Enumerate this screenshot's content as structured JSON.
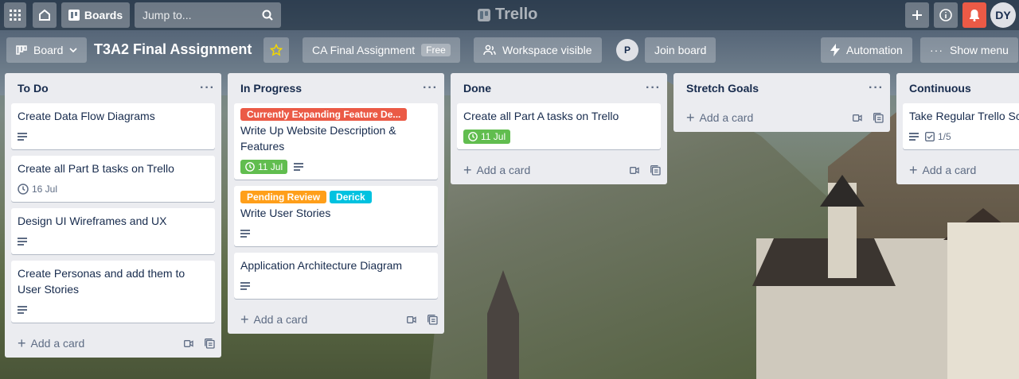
{
  "topbar": {
    "boards_label": "Boards",
    "search_placeholder": "Jump to...",
    "logo_text": "Trello",
    "avatar_initials": "DY"
  },
  "boardbar": {
    "view_label": "Board",
    "title": "T3A2 Final Assignment",
    "workspace_name": "CA Final Assignment",
    "workspace_badge": "Free",
    "visibility_label": "Workspace visible",
    "member_initial": "P",
    "join_label": "Join board",
    "automation_label": "Automation",
    "show_menu_label": "Show menu"
  },
  "lists": [
    {
      "title": "To Do",
      "cards": [
        {
          "title": "Create Data Flow Diagrams"
        },
        {
          "title": "Create all Part B tasks on Trello",
          "date": "16 Jul"
        },
        {
          "title": "Design UI Wireframes and UX"
        },
        {
          "title": "Create Personas and add them to User Stories"
        }
      ],
      "add_label": "Add a card"
    },
    {
      "title": "In Progress",
      "cards": [
        {
          "labels": [
            "Currently Expanding Feature De..."
          ],
          "title": "Write Up Website Description & Features",
          "date": "11 Jul"
        },
        {
          "labels": [
            "Pending Review",
            "Derick"
          ],
          "title": "Write User Stories"
        },
        {
          "title": "Application Architecture Diagram"
        }
      ],
      "add_label": "Add a card"
    },
    {
      "title": "Done",
      "cards": [
        {
          "title": "Create all Part A tasks on Trello",
          "date": "11 Jul"
        }
      ],
      "add_label": "Add a card"
    },
    {
      "title": "Stretch Goals",
      "cards": [],
      "add_label": "Add a card"
    },
    {
      "title": "Continuous",
      "cards": [
        {
          "title": "Take Regular Trello Sc",
          "checklist": "1/5"
        }
      ],
      "add_label": "Add a card"
    }
  ],
  "colors": {
    "label_red": "#eb5a46",
    "label_orange": "#ff9f1a",
    "label_sky": "#00c2e0",
    "due_green": "#61bd4f",
    "notif_red": "#eb5a46"
  }
}
